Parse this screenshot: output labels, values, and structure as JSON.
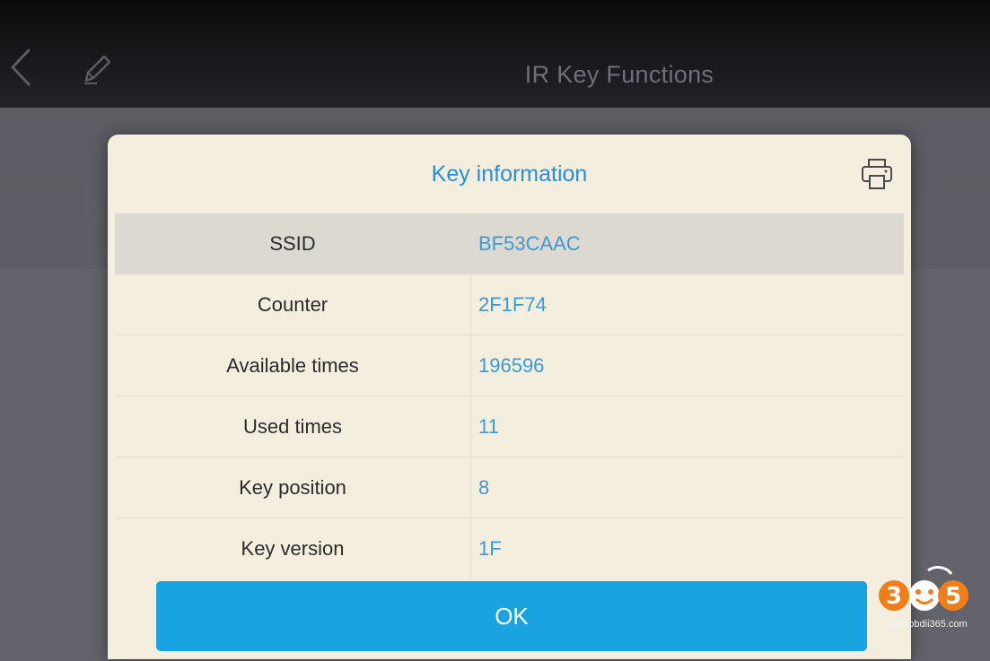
{
  "topbar": {
    "title": "IR Key Functions",
    "icons": {
      "back": "chevron-left-icon",
      "edit": "pencil-icon"
    }
  },
  "dialog": {
    "title": "Key information",
    "print_icon": "printer-icon",
    "rows": [
      {
        "label": "SSID",
        "value": "BF53CAAC"
      },
      {
        "label": "Counter",
        "value": "2F1F74"
      },
      {
        "label": "Available times",
        "value": "196596"
      },
      {
        "label": "Used times",
        "value": "11"
      },
      {
        "label": "Key position",
        "value": "8"
      },
      {
        "label": "Key version",
        "value": "1F"
      }
    ],
    "ok_label": "OK"
  },
  "watermark": {
    "logo_text": "365",
    "url": "www.obdii365.com"
  },
  "colors": {
    "accent": "#19a3e1",
    "title_blue": "#2a8fd8",
    "value_blue": "#3b9bd7",
    "dialog_bg": "#f3eedd",
    "logo_orange": "#f07f1a"
  }
}
